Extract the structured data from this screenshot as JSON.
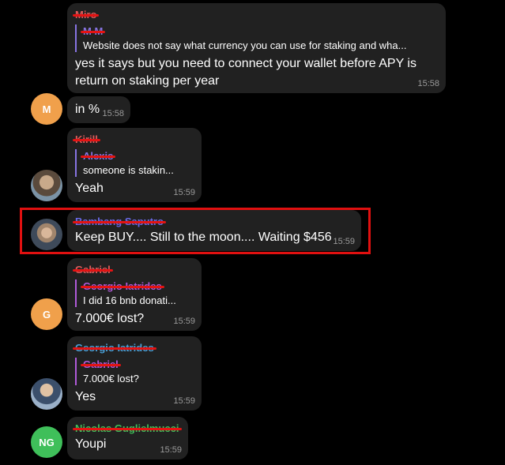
{
  "messages": [
    {
      "sender": "Miro",
      "sender_color": "#e05a5a",
      "reply": {
        "name": "M M",
        "color": "#8774e1",
        "text": "Website does not say what currency you can use for staking and wha..."
      },
      "text": "yes it says but you need to connect your wallet before APY is return on staking per year",
      "time": "15:58"
    },
    {
      "avatar_initial": "M",
      "avatar_color": "#f0a04b",
      "text": "in %",
      "time": "15:58"
    },
    {
      "sender": "Kirill",
      "sender_color": "#e05a5a",
      "reply": {
        "name": "Alexis",
        "color": "#8774e1",
        "text": "someone is stakin..."
      },
      "text": "Yeah",
      "time": "15:59"
    },
    {
      "sender": "Bambang Saputro",
      "sender_color": "#6a6ae8",
      "text": "Keep BUY.... Still to the moon.... Waiting $456",
      "time": "15:59"
    },
    {
      "avatar_initial": "G",
      "avatar_color": "#f0a04b",
      "sender": "Gabriel",
      "sender_color": "#e05a5a",
      "reply": {
        "name": "Georgio Iatrides",
        "color": "#b05ad8",
        "text": "I did 16 bnb donati..."
      },
      "text": "7.000€ lost?",
      "time": "15:59"
    },
    {
      "sender": "Georgio Iatrides",
      "sender_color": "#4aa0d8",
      "reply": {
        "name": "Gabriel",
        "color": "#b05ad8",
        "text": "7.000€ lost?"
      },
      "text": "Yes",
      "time": "15:59"
    },
    {
      "avatar_initial": "NG",
      "avatar_color": "#3fbf5a",
      "sender": "Nicolas Guglielmucci",
      "sender_color": "#3fbf5a",
      "text": "Youpi",
      "time": "15:59"
    }
  ]
}
